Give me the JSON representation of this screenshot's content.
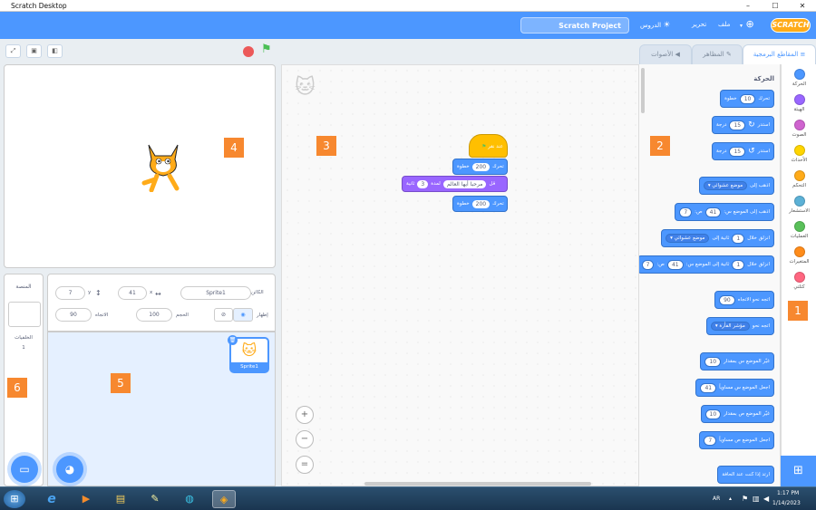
{
  "window": {
    "title": "Scratch Desktop",
    "minimize": "–",
    "maximize": "☐",
    "close": "✕"
  },
  "menubar": {
    "logo": "SCRATCH",
    "file": "ملف",
    "edit": "تحرير",
    "tutorials": "الدروس",
    "project_name": "Scratch Project"
  },
  "tabs": {
    "code": "المقاطع البرمجية",
    "costumes": "المظاهر",
    "sounds": "الأصوات"
  },
  "categories": [
    {
      "label": "الحركة",
      "color": "#4c97ff"
    },
    {
      "label": "الهيئة",
      "color": "#9966ff"
    },
    {
      "label": "الصوت",
      "color": "#cf63cf"
    },
    {
      "label": "الأحداث",
      "color": "#ffd500"
    },
    {
      "label": "التحكم",
      "color": "#ffab19"
    },
    {
      "label": "الاستشعار",
      "color": "#5cb1d6"
    },
    {
      "label": "العمليات",
      "color": "#59c059"
    },
    {
      "label": "المتغيرات",
      "color": "#ff8c1a"
    },
    {
      "label": "كتلتي",
      "color": "#ff6680"
    }
  ],
  "palette": {
    "heading": "الحركة",
    "blocks": [
      {
        "label": "تحرك",
        "value": "10",
        "suffix": "خطوة"
      },
      {
        "label": "استدر",
        "value": "15",
        "suffix": "درجة",
        "icon": "↻"
      },
      {
        "label": "استدر",
        "value": "15",
        "suffix": "درجة",
        "icon": "↺"
      },
      {
        "label": "اذهب إلى",
        "dropdown": "موضع عشوائي ▾"
      },
      {
        "label": "اذهب إلى الموضع س:",
        "value": "41",
        "label2": "ص:",
        "value2": "7"
      },
      {
        "label": "انزلق خلال",
        "value": "1",
        "label2": "ثانية إلى",
        "dropdown": "موضع عشوائي ▾"
      },
      {
        "label": "انزلق خلال",
        "value": "1",
        "label2": "ثانية إلى الموضع س:",
        "value2": "41",
        "label3": "ص:",
        "value3": "7"
      },
      {
        "label": "اتجه نحو الاتجاه",
        "value": "90"
      },
      {
        "label": "اتجه نحو",
        "dropdown": "مؤشر الفأرة ▾"
      },
      {
        "label": "غيّر الموضع س بمقدار",
        "value": "10"
      },
      {
        "label": "اجعل الموضع س مساوياً",
        "value": "41"
      },
      {
        "label": "غيّر الموضع ص بمقدار",
        "value": "10"
      },
      {
        "label": "اجعل الموضع ص مساوياً",
        "value": "7"
      },
      {
        "label": "ارتد إذا كنت عند الحافة"
      }
    ]
  },
  "script": {
    "hat": "عند نقر",
    "move1": {
      "label": "تحرك",
      "value": "200",
      "suffix": "خطوة"
    },
    "say": {
      "label": "قل",
      "text": "مرحبا أيها العالم",
      "for": "لمدة",
      "secs": "3",
      "unit": "ثانية"
    },
    "move2": {
      "label": "تحرك",
      "value": "200",
      "suffix": "خطوة"
    }
  },
  "zoom": {
    "in": "+",
    "out": "−",
    "reset": "="
  },
  "sprite_info": {
    "sprite_label": "الكائن",
    "sprite_name": "Sprite1",
    "x_label": "x",
    "x_value": "41",
    "y_label": "y",
    "y_value": "7",
    "show_label": "إظهار",
    "size_label": "الحجم",
    "size_value": "100",
    "direction_label": "الاتجاه",
    "direction_value": "90"
  },
  "sprite_tile": {
    "name": "Sprite1"
  },
  "stage_pane": {
    "title": "المنصة",
    "backdrops_label": "الخلفيات",
    "backdrops_count": "1"
  },
  "markers": [
    "1",
    "2",
    "3",
    "4",
    "5",
    "6"
  ],
  "taskbar": {
    "lang": "AR",
    "time": "1:17 PM",
    "date": "1/14/2023"
  }
}
